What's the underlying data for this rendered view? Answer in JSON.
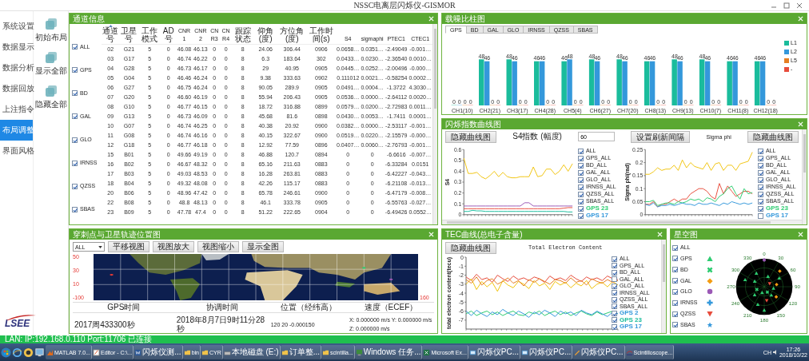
{
  "window": {
    "title": "NSSC电离层闪烁仪-GISMOR"
  },
  "sidebar": {
    "items": [
      {
        "label": "系统设置",
        "selected": false
      },
      {
        "label": "数据显示",
        "selected": false
      },
      {
        "label": "数据分析",
        "selected": false
      },
      {
        "label": "数据回放",
        "selected": false
      },
      {
        "label": "上注指令",
        "selected": false
      },
      {
        "label": "布局调整",
        "selected": true
      },
      {
        "label": "界面风格",
        "selected": false
      }
    ],
    "actions": [
      {
        "label": "初始布局"
      },
      {
        "label": "显示全部"
      },
      {
        "label": "隐藏全部"
      }
    ],
    "logo": "LSEE"
  },
  "channel_panel": {
    "title": "通道信息",
    "filters": [
      {
        "label": "ALL",
        "checked": true
      },
      {
        "label": "GPS",
        "checked": true
      },
      {
        "label": "BD",
        "checked": true
      },
      {
        "label": "GAL",
        "checked": true
      },
      {
        "label": "GLO",
        "checked": true
      },
      {
        "label": "IRNSS",
        "checked": true
      },
      {
        "label": "QZSS",
        "checked": true
      },
      {
        "label": "SBAS",
        "checked": true
      }
    ],
    "columns": [
      {
        "label": "通道号",
        "sorted": true
      },
      {
        "label": "卫星号",
        "sorted": false
      },
      {
        "label": "工作模式",
        "sorted": false
      },
      {
        "label": "AD号",
        "sorted": false
      },
      {
        "label": "CNR1",
        "sorted": false
      },
      {
        "label": "CNR2",
        "sorted": false
      },
      {
        "label": "CNR3",
        "sorted": false
      },
      {
        "label": "CNR4",
        "sorted": false
      },
      {
        "label": "跟踪状态",
        "sorted": false
      },
      {
        "label": "仰角(度)",
        "sorted": false
      },
      {
        "label": "方位角(度)",
        "sorted": false
      },
      {
        "label": "工作时间(s)",
        "sorted": false
      },
      {
        "label": "S4",
        "sorted": false
      },
      {
        "label": "sigmaphi",
        "sorted": false
      },
      {
        "label": "PTEC1",
        "sorted": false
      },
      {
        "label": "CTEC1",
        "sorted": false
      }
    ],
    "rows": [
      [
        "02",
        "G21",
        "5",
        "0",
        "46.08",
        "46.13",
        "0",
        "0",
        "8",
        "24.06",
        "306.44",
        "0906",
        "0.0658…",
        "0.0351…",
        "-2.49049",
        "-0.001…"
      ],
      [
        "03",
        "G17",
        "5",
        "0",
        "46.74",
        "46.22",
        "0",
        "0",
        "8",
        "6.3",
        "183.64",
        "302",
        "0.0433…",
        "0.0230…",
        "-2.36540",
        "0.0010…"
      ],
      [
        "04",
        "G28",
        "5",
        "0",
        "46.73",
        "46.17",
        "0",
        "0",
        "8",
        "29",
        "40.95",
        "0905",
        "0.0445…",
        "0.0252…",
        "-2.00496",
        "-0.000…"
      ],
      [
        "05",
        "G04",
        "5",
        "0",
        "46.46",
        "46.24",
        "0",
        "0",
        "8",
        "9.38",
        "333.63",
        "0902",
        "0.111012",
        "0.0021…",
        "-0.58254",
        "0.0002…"
      ],
      [
        "06",
        "G27",
        "5",
        "0",
        "46.75",
        "46.24",
        "0",
        "0",
        "8",
        "90.05",
        "289.9",
        "0905",
        "0.0491…",
        "0.0004…",
        "-1.3722",
        "4.3030…"
      ],
      [
        "07",
        "G20",
        "5",
        "0",
        "46.60",
        "46.19",
        "0",
        "0",
        "8",
        "55.94",
        "206.43",
        "0905",
        "0.0536…",
        "0.0000…",
        "-2.64112",
        "0.0020…"
      ],
      [
        "08",
        "G10",
        "5",
        "0",
        "46.77",
        "46.15",
        "0",
        "0",
        "8",
        "18.72",
        "316.88",
        "0899",
        "0.0579…",
        "0.0200…",
        "-2.72983",
        "0.0011…"
      ],
      [
        "09",
        "G13",
        "5",
        "0",
        "46.73",
        "46.09",
        "0",
        "0",
        "8",
        "45.68",
        "81.6",
        "0898",
        "0.0430…",
        "0.0053…",
        "-1.7411",
        "0.0001…"
      ],
      [
        "10",
        "G07",
        "5",
        "0",
        "46.74",
        "46.25",
        "0",
        "0",
        "8",
        "40.38",
        "20.92",
        "0900",
        "0.0382…",
        "0.0000…",
        "-2.53117",
        "-0.001…"
      ],
      [
        "11",
        "G08",
        "5",
        "0",
        "46.74",
        "46.16",
        "0",
        "0",
        "8",
        "40.15",
        "322.67",
        "0900",
        "0.0519…",
        "0.0220…",
        "-2.15579",
        "-0.000…"
      ],
      [
        "12",
        "G18",
        "5",
        "0",
        "46.77",
        "46.18",
        "0",
        "0",
        "8",
        "12.92",
        "77.59",
        "0896",
        "0.0407…",
        "0.0060…",
        "-2.76793",
        "-0.001…"
      ],
      [
        "15",
        "B01",
        "5",
        "0",
        "49.66",
        "49.19",
        "0",
        "0",
        "8",
        "46.88",
        "120.7",
        "0894",
        "0",
        "0",
        "-6.6616",
        "-0.007…"
      ],
      [
        "16",
        "B02",
        "5",
        "0",
        "46.67",
        "48.32",
        "0",
        "0",
        "8",
        "65.16",
        "211.63",
        "0883",
        "0",
        "0",
        "-6.33284",
        "0.0151"
      ],
      [
        "17",
        "B03",
        "5",
        "0",
        "49.03",
        "48.53",
        "0",
        "0",
        "8",
        "16.28",
        "263.81",
        "0883",
        "0",
        "0",
        "-6.42227",
        "-0.043…"
      ],
      [
        "18",
        "B04",
        "5",
        "0",
        "49.32",
        "48.08",
        "0",
        "0",
        "8",
        "42.26",
        "115.17",
        "0883",
        "0",
        "0",
        "-6.21108",
        "-0.013…"
      ],
      [
        "20",
        "B06",
        "5",
        "0",
        "48.96",
        "47.42",
        "0",
        "0",
        "8",
        "65.78",
        "246.61",
        "0900",
        "0",
        "0",
        "-6.47179",
        "-0.008…"
      ],
      [
        "22",
        "B08",
        "5",
        "0",
        "48.8",
        "48.13",
        "0",
        "0",
        "8",
        "46.1",
        "333.78",
        "0905",
        "0",
        "0",
        "-6.55763",
        "-0.027…"
      ],
      [
        "23",
        "B09",
        "5",
        "0",
        "47.78",
        "47.4",
        "0",
        "0",
        "8",
        "51.22",
        "222.65",
        "0904",
        "0",
        "0",
        "-6.49426",
        "0.0552…"
      ]
    ]
  },
  "map_panel": {
    "title": "穿刺点与卫星轨迹位置图",
    "layer_select": "ALL",
    "buttons": [
      "平移视图",
      "视图放大",
      "视图缩小",
      "显示全图"
    ],
    "lat_labels": [
      "50",
      "30",
      "10"
    ],
    "lon_labels": [
      "-100",
      "160"
    ],
    "info_columns": [
      "GPS时间",
      "协调时间",
      "位置（经纬高）",
      "速度（ECEF）"
    ],
    "info_values": [
      "2017周433300秒",
      "2018年8月7日9时11分28秒",
      "120 20 -0.000150",
      "X: 0.000000 m/s Y: 0.000000 m/s Z: 0.000000 m/s"
    ]
  },
  "cnr_panel": {
    "title": "载噪比柱图",
    "tabs": [
      {
        "label": "GPS",
        "selected": true
      },
      {
        "label": "BD",
        "selected": false
      },
      {
        "label": "GAL",
        "selected": false
      },
      {
        "label": "GLO",
        "selected": false
      },
      {
        "label": "IRNSS",
        "selected": false
      },
      {
        "label": "QZSS",
        "selected": false
      },
      {
        "label": "SBAS",
        "selected": false
      }
    ],
    "chart_data": {
      "type": "bar",
      "categories": [
        "CH1(10)",
        "CH2(21)",
        "CH3(17)",
        "CH4(28)",
        "CH5(4)",
        "CH6(27)",
        "CH7(20)",
        "CH8(13)",
        "CH9(13)",
        "CH10(7)",
        "CH11(8)",
        "CH12(18)"
      ],
      "data_labels": true,
      "series": [
        {
          "name": "L1",
          "color": "#1abc9c",
          "values": [
            0,
            48,
            48,
            46,
            46,
            48,
            48,
            46,
            48,
            48,
            46,
            46
          ]
        },
        {
          "name": "L2",
          "color": "#3498db",
          "values": [
            0,
            46,
            46,
            46,
            48,
            46,
            46,
            46,
            46,
            46,
            46,
            46
          ]
        },
        {
          "name": "L5",
          "color": "#e67e22",
          "values": [
            0,
            0,
            0,
            0,
            0,
            0,
            0,
            0,
            0,
            0,
            0,
            0
          ]
        },
        {
          "name": "-",
          "color": "#e74c3c",
          "values": [
            0,
            0,
            0,
            0,
            0,
            0,
            0,
            0,
            0,
            0,
            0,
            0
          ]
        }
      ]
    }
  },
  "scint_panel": {
    "title": "闪烁指数曲线图",
    "left_button": "隐藏曲线图",
    "interval_value": "60",
    "interval_button": "设置刷新间隔",
    "right_button": "隐藏曲线图",
    "s4_chart": {
      "chart_data": {
        "type": "line",
        "title": "S4指数 (幅度)",
        "ylabel": "S4",
        "ylim": [
          0,
          0.6
        ],
        "yticks": [
          0,
          0.1,
          0.2,
          0.3,
          0.4,
          0.5,
          0.6
        ],
        "series": [
          {
            "color": "#f1c40f",
            "values": [
              0.52,
              0.38,
              0.38,
              0.39,
              0.35,
              0.33,
              0.36,
              0.4,
              0.35,
              0.39,
              0.35,
              0.34,
              0.34,
              0.35,
              0.35,
              0.35,
              0.44,
              0.35,
              0.36,
              0.42,
              0.42,
              0.37,
              0.4,
              0.46,
              0.4,
              0.47
            ]
          },
          {
            "color": "#9b59b6",
            "values": [
              0.08,
              0.08,
              0.08,
              0.08,
              0.08,
              0.08,
              0.08,
              0.08,
              0.08,
              0.08,
              0.08,
              0.08,
              0.08,
              0.08,
              0.11,
              0.11,
              0.08,
              0.08,
              0.08,
              0.08,
              0.08,
              0.08,
              0.08,
              0.08,
              0.08,
              0.08
            ]
          },
          {
            "color": "#e74c3c",
            "values": [
              0.055,
              0.055,
              0.055,
              0.055,
              0.055,
              0.055,
              0.055,
              0.055,
              0.055,
              0.055,
              0.055,
              0.055,
              0.055,
              0.055,
              0.055,
              0.055,
              0.055,
              0.055,
              0.055,
              0.055,
              0.055,
              0.055,
              0.055,
              0.06,
              0.065,
              0.065
            ]
          },
          {
            "color": "#1abc9c",
            "values": [
              0.03,
              0.03,
              0.04,
              0.035,
              0.035,
              0.03,
              0.03,
              0.03,
              0.03,
              0.03,
              0.03,
              0.03,
              0.03,
              0.03,
              0.03,
              0.03,
              0.03,
              0.03,
              0.03,
              0.03,
              0.03,
              0.03,
              0.03,
              0.03,
              0.025,
              0.025
            ]
          }
        ]
      },
      "legend": [
        {
          "label": "ALL",
          "checked": true
        },
        {
          "label": "GPS_ALL",
          "checked": true
        },
        {
          "label": "BD_ALL",
          "checked": true
        },
        {
          "label": "GAL_ALL",
          "checked": true
        },
        {
          "label": "GLO_ALL",
          "checked": true
        },
        {
          "label": "IRNSS_ALL",
          "checked": true
        },
        {
          "label": "QZSS_ALL",
          "checked": true
        },
        {
          "label": "SBAS_ALL",
          "checked": true
        },
        {
          "label": "GPS 23",
          "checked": true,
          "color": "#2ecc71"
        },
        {
          "label": "GPS 17",
          "checked": true,
          "color": "#3498db"
        }
      ]
    },
    "sigma_chart": {
      "chart_data": {
        "type": "line",
        "title": "Sigma phi",
        "ylabel": "Sigma phi(rad)",
        "ylim": [
          0,
          0.25
        ],
        "yticks": [
          0,
          0.05,
          0.1,
          0.15,
          0.2,
          0.25
        ],
        "series": [
          {
            "color": "#f1c40f",
            "values": [
              0.155,
              0.155,
              0.165,
              0.18,
              0.17,
              0.175,
              0.175,
              0.19,
              0.17,
              0.21,
              0.18,
              0.2,
              0.185,
              0.18,
              0.175,
              0.2,
              0.17,
              0.195,
              0.2,
              0.17,
              0.19,
              0.19,
              0.17,
              0.195,
              0.2,
              0.205,
              0.24
            ]
          },
          {
            "color": "#e74c3c",
            "values": [
              0.04,
              0.04,
              0.05,
              0.03,
              0.04,
              0.04,
              0.05,
              0.06,
              0.05,
              0.06,
              0.06,
              0.08,
              0.09,
              0.1,
              0.1,
              0.09,
              0.07,
              0.06,
              0.12,
              0.08,
              0.11,
              0.09,
              0.07,
              0.08,
              0.09,
              0.09,
              0.08
            ]
          },
          {
            "color": "#2ecc71",
            "values": [
              0.05,
              0.05,
              0.055,
              0.035,
              0.04,
              0.045,
              0.045,
              0.04,
              0.05,
              0.045,
              0.05,
              0.06,
              0.055,
              0.06,
              0.05,
              0.065,
              0.06,
              0.05,
              0.07,
              0.08,
              0.1,
              0.11,
              0.08,
              0.06,
              0.1,
              0.08,
              0.085
            ]
          },
          {
            "color": "#3498db",
            "values": [
              0.04,
              0.035,
              0.045,
              0.03,
              0.035,
              0.035,
              0.04,
              0.035,
              0.04,
              0.045,
              0.04,
              0.04,
              0.035,
              0.045,
              0.04,
              0.04,
              0.045,
              0.04,
              0.035,
              0.045,
              0.04,
              0.05,
              0.045,
              0.04,
              0.045,
              0.04,
              0.045
            ]
          }
        ]
      },
      "legend": [
        {
          "label": "ALL",
          "checked": true
        },
        {
          "label": "GPS_ALL",
          "checked": true
        },
        {
          "label": "BD_ALL",
          "checked": true
        },
        {
          "label": "GAL_ALL",
          "checked": true
        },
        {
          "label": "GLO_ALL",
          "checked": true
        },
        {
          "label": "IRNSS_ALL",
          "checked": true
        },
        {
          "label": "QZSS_ALL",
          "checked": true
        },
        {
          "label": "SBAS_ALL",
          "checked": true
        },
        {
          "label": "GPS 23",
          "checked": true,
          "color": "#2ecc71"
        },
        {
          "label": "GPS 17",
          "checked": false,
          "color": "#3498db"
        }
      ]
    }
  },
  "tec_panel": {
    "title": "TEC曲线(总电子含量)",
    "button": "隐藏曲线图",
    "chart_data": {
      "type": "line",
      "title": "Total Electron Content",
      "ylabel": "total electron content(tecu)",
      "ylim": [
        -8,
        0
      ],
      "yticks": [
        0,
        -1,
        -2,
        -3,
        -4,
        -5,
        -6,
        -7
      ],
      "series": [
        {
          "color": "#e74c3c",
          "values": [
            -2.2,
            -2.6,
            -1.9,
            -2.5,
            -2.3,
            -2.8,
            -2.0,
            -2.4,
            -2.7,
            -2.1,
            -2.5,
            -2.3,
            -2.6,
            -2.2,
            -2.4,
            -2.8,
            -2.1,
            -2.5,
            -2.3,
            -2.6,
            -2.0,
            -2.4,
            -2.7,
            -2.2,
            -2.5,
            -2.3,
            -2.6,
            -2.1,
            -2.4,
            -2.5
          ]
        },
        {
          "color": "#f1c40f",
          "values": [
            -3.0,
            -2.4,
            -3.6,
            -2.7,
            -3.3,
            -2.8,
            -3.8,
            -2.6,
            -3.1,
            -3.4,
            -2.7,
            -3.0,
            -3.5,
            -2.6,
            -3.2,
            -2.9,
            -3.6,
            -2.7,
            -3.1,
            -2.8,
            -3.4,
            -2.9,
            -3.2,
            -2.6,
            -3.5,
            -3.0,
            -2.8,
            -3.3,
            -2.7,
            -3.1
          ]
        },
        {
          "color": "#e67e22",
          "values": [
            -2.5,
            -2.9,
            -2.2,
            -3.1,
            -2.6,
            -2.4,
            -3.0,
            -2.7,
            -2.3,
            -2.9,
            -2.6,
            -3.2,
            -2.5,
            -2.8,
            -2.4,
            -2.7,
            -3.0,
            -2.5,
            -2.6,
            -2.9,
            -2.3,
            -2.8,
            -2.6,
            -3.1,
            -2.4,
            -2.7,
            -2.9,
            -2.5,
            -2.8,
            -2.6
          ]
        },
        {
          "color": "#2ecc71",
          "values": [
            -6.3,
            -6.0,
            -6.5,
            -6.2,
            -6.0,
            -6.4,
            -6.1,
            -6.5,
            -6.2,
            -6.0,
            -6.4,
            -6.5,
            -6.1,
            -6.3,
            -6.0,
            -6.5,
            -6.2,
            -6.0,
            -6.4,
            -6.1,
            -6.5,
            -6.2,
            -6.0,
            -6.3,
            -6.5,
            -6.1,
            -6.4,
            -6.2,
            -6.0,
            -6.3
          ]
        },
        {
          "color": "#3498db",
          "values": [
            -6.0,
            -6.5,
            -5.9,
            -6.3,
            -6.6,
            -6.1,
            -6.4,
            -5.8,
            -6.2,
            -6.5,
            -6.0,
            -6.3,
            -6.7,
            -6.1,
            -6.4,
            -5.9,
            -6.2,
            -6.6,
            -6.0,
            -6.3,
            -6.1,
            -6.5,
            -5.9,
            -6.2,
            -6.4,
            -6.0,
            -6.3,
            -6.6,
            -6.1,
            -6.3
          ]
        }
      ]
    },
    "legend": [
      {
        "label": "ALL",
        "checked": true
      },
      {
        "label": "GPS_ALL",
        "checked": true
      },
      {
        "label": "BD_ALL",
        "checked": true
      },
      {
        "label": "GAL_ALL",
        "checked": false
      },
      {
        "label": "GLO_ALL",
        "checked": true
      },
      {
        "label": "IRNSS_ALL",
        "checked": true
      },
      {
        "label": "QZSS_ALL",
        "checked": true
      },
      {
        "label": "SBAS_ALL",
        "checked": true
      },
      {
        "label": "GPS 2",
        "checked": true,
        "color": "#3498db"
      },
      {
        "label": "GPS 23",
        "checked": true,
        "color": "#1abc9c"
      },
      {
        "label": "GPS 17",
        "checked": true,
        "color": "#3498db"
      }
    ]
  },
  "sky_panel": {
    "title": "星空图",
    "systems": [
      {
        "label": "ALL",
        "checked": true,
        "kind": "none"
      },
      {
        "label": "GPS",
        "checked": true,
        "kind": "triangle",
        "color": "#2ecc71"
      },
      {
        "label": "BD",
        "checked": true,
        "kind": "cross",
        "color": "#2ecc71"
      },
      {
        "label": "GAL",
        "checked": true,
        "kind": "diamond",
        "color": "#f39c12"
      },
      {
        "label": "GLO",
        "checked": true,
        "kind": "circle",
        "color": "#9b59b6"
      },
      {
        "label": "IRNSS",
        "checked": true,
        "kind": "plus",
        "color": "#3498db"
      },
      {
        "label": "QZSS",
        "checked": true,
        "kind": "down",
        "color": "#e74c3c"
      },
      {
        "label": "SBAS",
        "checked": true,
        "kind": "star",
        "color": "#3498db"
      }
    ],
    "azimuth_labels": [
      "0",
      "30",
      "60",
      "90",
      "120",
      "150",
      "180",
      "210",
      "240",
      "270",
      "300",
      "330"
    ]
  },
  "status_bar": {
    "text": "LAN: IP:192.168.0.110 Port:11706 已连接"
  },
  "taskbar": {
    "items": [
      {
        "label": "MATLAB 7.0...",
        "kind": "matlab"
      },
      {
        "label": "Editor - C:\\...",
        "kind": "editor"
      },
      {
        "label": "闪烁仪测...",
        "kind": "word"
      },
      {
        "label": "bin",
        "kind": "folder"
      },
      {
        "label": "CYR",
        "kind": "folder"
      },
      {
        "label": "本地磁盘 (E:)",
        "kind": "drive"
      },
      {
        "label": "订单整...",
        "kind": "folder"
      },
      {
        "label": "scintilla...",
        "kind": "folder"
      },
      {
        "label": "Windows 任务...",
        "kind": "monitor"
      },
      {
        "label": "Microsoft Ex...",
        "kind": "excel"
      },
      {
        "label": "闪烁仪PC...",
        "kind": "app"
      },
      {
        "label": "闪烁仪PC...",
        "kind": "app"
      },
      {
        "label": "闪烁仪PC...",
        "kind": "pen"
      },
      {
        "label": "Scintilloscope...",
        "kind": "scope"
      }
    ],
    "tray": {
      "language": "CH",
      "time": "17:26",
      "date": "2018/10/22"
    }
  }
}
